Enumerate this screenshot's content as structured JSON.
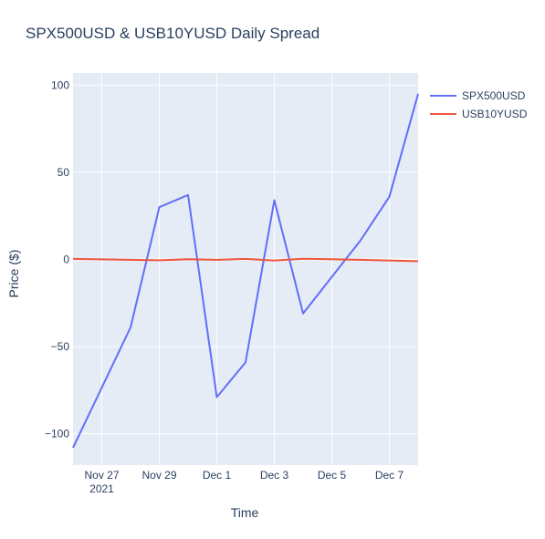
{
  "chart_data": {
    "type": "line",
    "title": "SPX500USD & USB10YUSD Daily Spread",
    "xlabel": "Time",
    "ylabel": "Price ($)",
    "xlim": [
      "2021-11-26",
      "2021-12-08"
    ],
    "ylim": [
      -118,
      107
    ],
    "y_ticks": [
      -100,
      -50,
      0,
      50,
      100
    ],
    "y_tick_labels": [
      "−100",
      "−50",
      "0",
      "50",
      "100"
    ],
    "x_ticks": [
      "2021-11-27",
      "2021-11-29",
      "2021-12-01",
      "2021-12-03",
      "2021-12-05",
      "2021-12-07"
    ],
    "x_tick_labels": [
      "Nov 27",
      "Nov 29",
      "Dec 1",
      "Dec 3",
      "Dec 5",
      "Dec 7"
    ],
    "x_tick_year": "2021",
    "grid": true,
    "legend_position": "top-right",
    "background_color": "#e5ecf6",
    "series": [
      {
        "name": "SPX500USD",
        "color": "#636efa",
        "x": [
          "2021-11-26",
          "2021-11-28",
          "2021-11-29",
          "2021-11-30",
          "2021-12-01",
          "2021-12-02",
          "2021-12-03",
          "2021-12-04",
          "2021-12-05",
          "2021-12-06",
          "2021-12-07",
          "2021-12-08"
        ],
        "values": [
          -108,
          -39,
          30,
          37,
          -79,
          -59,
          34,
          -31,
          -10,
          11,
          36,
          95
        ]
      },
      {
        "name": "USB10YUSD",
        "color": "#ef553b",
        "x": [
          "2021-11-26",
          "2021-11-28",
          "2021-11-29",
          "2021-11-30",
          "2021-12-01",
          "2021-12-02",
          "2021-12-03",
          "2021-12-04",
          "2021-12-05",
          "2021-12-06",
          "2021-12-07",
          "2021-12-08"
        ],
        "values": [
          0.3,
          -0.2,
          -0.5,
          0.1,
          -0.2,
          0.3,
          -0.6,
          0.4,
          0.1,
          -0.2,
          -0.6,
          -1.0
        ]
      }
    ]
  }
}
